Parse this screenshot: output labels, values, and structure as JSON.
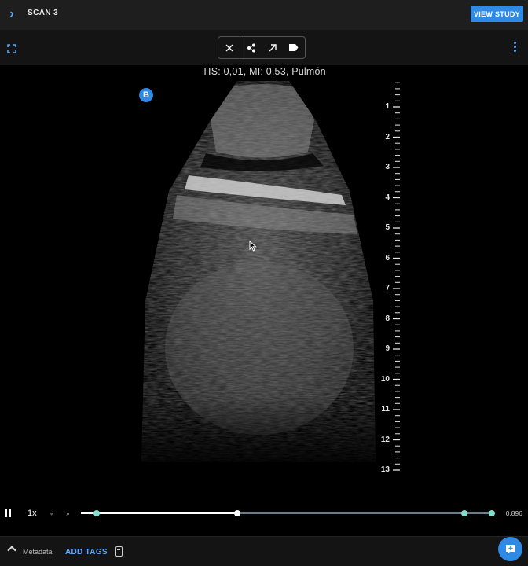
{
  "header": {
    "title": "SCAN 3",
    "view_study_label": "VIEW STUDY",
    "colors": {
      "accent": "#2f8ae6",
      "bar": "#1e1e1e"
    }
  },
  "toolbar": {
    "icons": [
      "close-icon",
      "share-icon",
      "arrow-icon",
      "tag-icon"
    ]
  },
  "viewer": {
    "overlay": "TIS: 0,01, MI: 0,53, Pulmón",
    "badge": "B",
    "depth_labels": [
      "1",
      "2",
      "3",
      "4",
      "5",
      "6",
      "7",
      "8",
      "9",
      "10",
      "11",
      "12",
      "13"
    ]
  },
  "playback": {
    "speed": "1x",
    "prev_label": "«",
    "next_label": "»",
    "frame_value": "0.896",
    "progress_fraction": 0.38
  },
  "footer": {
    "metadata_label": "Metadata",
    "add_tags_label": "ADD TAGS"
  }
}
